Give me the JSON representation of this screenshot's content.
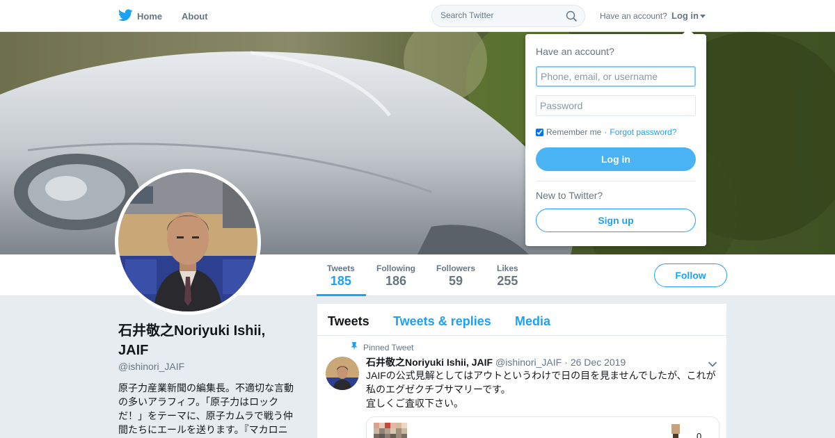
{
  "nav": {
    "home_label": "Home",
    "about_label": "About",
    "search_placeholder": "Search Twitter",
    "account_question": "Have an account?",
    "login_label": "Log in",
    "brand_color": "#1da1f2"
  },
  "login_dropdown": {
    "title": "Have an account?",
    "username_placeholder": "Phone, email, or username",
    "password_placeholder": "Password",
    "remember_label": "Remember me",
    "separator": "·",
    "forgot_label": "Forgot password?",
    "remember_checked": true,
    "login_button": "Log in",
    "new_question": "New to Twitter?",
    "signup_button": "Sign up"
  },
  "profile": {
    "name": "石井敬之Noriyuki Ishii, JAIF",
    "handle": "@ishinori_JAIF",
    "bio": "原子力産業新聞の編集長。不適切な言動の多いアラフィフ。「原子力はロックだ！」をテーマに、原子カムラで戦う仲間たちにエールを送ります。『マカロニ",
    "stats": [
      {
        "label": "Tweets",
        "value": "185"
      },
      {
        "label": "Following",
        "value": "186"
      },
      {
        "label": "Followers",
        "value": "59"
      },
      {
        "label": "Likes",
        "value": "255"
      }
    ],
    "follow_button": "Follow"
  },
  "timeline": {
    "tabs": [
      "Tweets",
      "Tweets & replies",
      "Media"
    ],
    "pinned_tweet": {
      "pinned_label": "Pinned Tweet",
      "author_name": "石井敬之Noriyuki Ishii, JAIF",
      "author_handle": "@ishinori_JAIF",
      "separator": "·",
      "date": "26 Dec 2019",
      "text_lines": [
        "JAIFの公式見解としてはアウトというわけで日の目を見ませんでしたが、これが",
        "私のエグゼクチブサマリーです。",
        "宜しくご査収下さい。"
      ],
      "card_count": "0"
    }
  },
  "icons": {
    "brand": "twitter-bird-icon",
    "search": "search-icon",
    "pin": "pin-icon",
    "chevron": "chevron-down-icon"
  }
}
